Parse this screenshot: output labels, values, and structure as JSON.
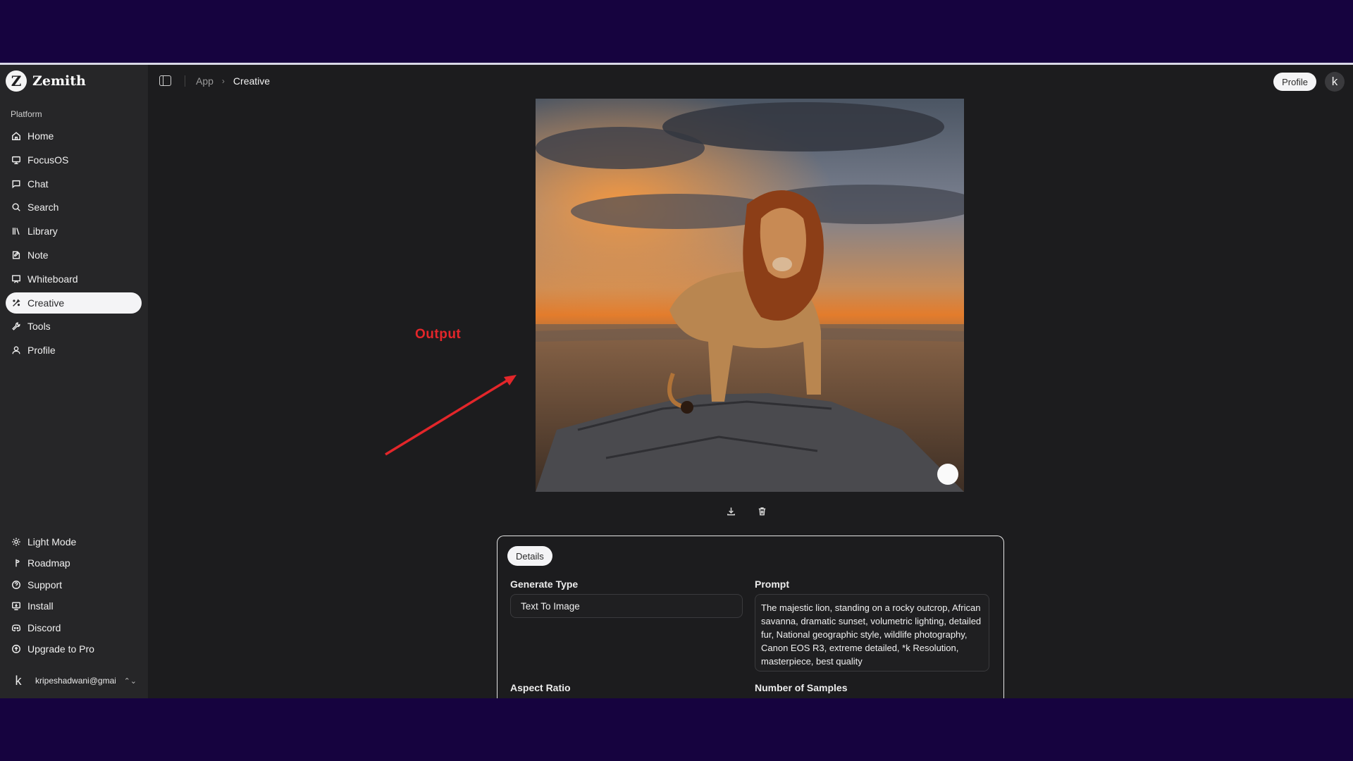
{
  "app": {
    "name": "Zemith",
    "logo_letter": "Z"
  },
  "sidebar": {
    "section_label": "Platform",
    "items": [
      {
        "label": "Home",
        "icon": "home-icon"
      },
      {
        "label": "FocusOS",
        "icon": "monitor-icon"
      },
      {
        "label": "Chat",
        "icon": "chat-icon"
      },
      {
        "label": "Search",
        "icon": "search-icon"
      },
      {
        "label": "Library",
        "icon": "library-icon"
      },
      {
        "label": "Note",
        "icon": "note-icon"
      },
      {
        "label": "Whiteboard",
        "icon": "whiteboard-icon"
      },
      {
        "label": "Creative",
        "icon": "palette-icon",
        "active": true
      },
      {
        "label": "Tools",
        "icon": "wrench-icon"
      },
      {
        "label": "Profile",
        "icon": "user-icon"
      }
    ],
    "bottom_items": [
      {
        "label": "Light Mode",
        "icon": "sun-icon"
      },
      {
        "label": "Roadmap",
        "icon": "milestone-icon"
      },
      {
        "label": "Support",
        "icon": "help-circle-icon"
      },
      {
        "label": "Install",
        "icon": "download-monitor-icon"
      },
      {
        "label": "Discord",
        "icon": "discord-icon"
      },
      {
        "label": "Upgrade to Pro",
        "icon": "upgrade-icon"
      }
    ],
    "user": {
      "avatar_letter": "k",
      "email": "kripeshadwani@gmai..."
    }
  },
  "topbar": {
    "breadcrumb": {
      "root": "App",
      "current": "Creative"
    },
    "profile_button": "Profile",
    "avatar_letter": "k"
  },
  "annotation": {
    "label": "Output",
    "color": "#e3262a"
  },
  "details": {
    "tab_label": "Details",
    "generate_type_label": "Generate Type",
    "generate_type_value": "Text To Image",
    "prompt_label": "Prompt",
    "prompt_value": "The majestic lion, standing on a rocky outcrop, African savanna, dramatic sunset, volumetric lighting, detailed fur, National geographic style, wildlife photography, Canon EOS R3, extreme detailed, *k Resolution, masterpiece, best quality",
    "aspect_ratio_label": "Aspect Ratio",
    "num_samples_label": "Number of Samples"
  },
  "colors": {
    "outer_background": "#16033f",
    "app_background": "#1c1c1e",
    "sidebar_background": "#262628",
    "active_item": "#f4f4f6"
  }
}
